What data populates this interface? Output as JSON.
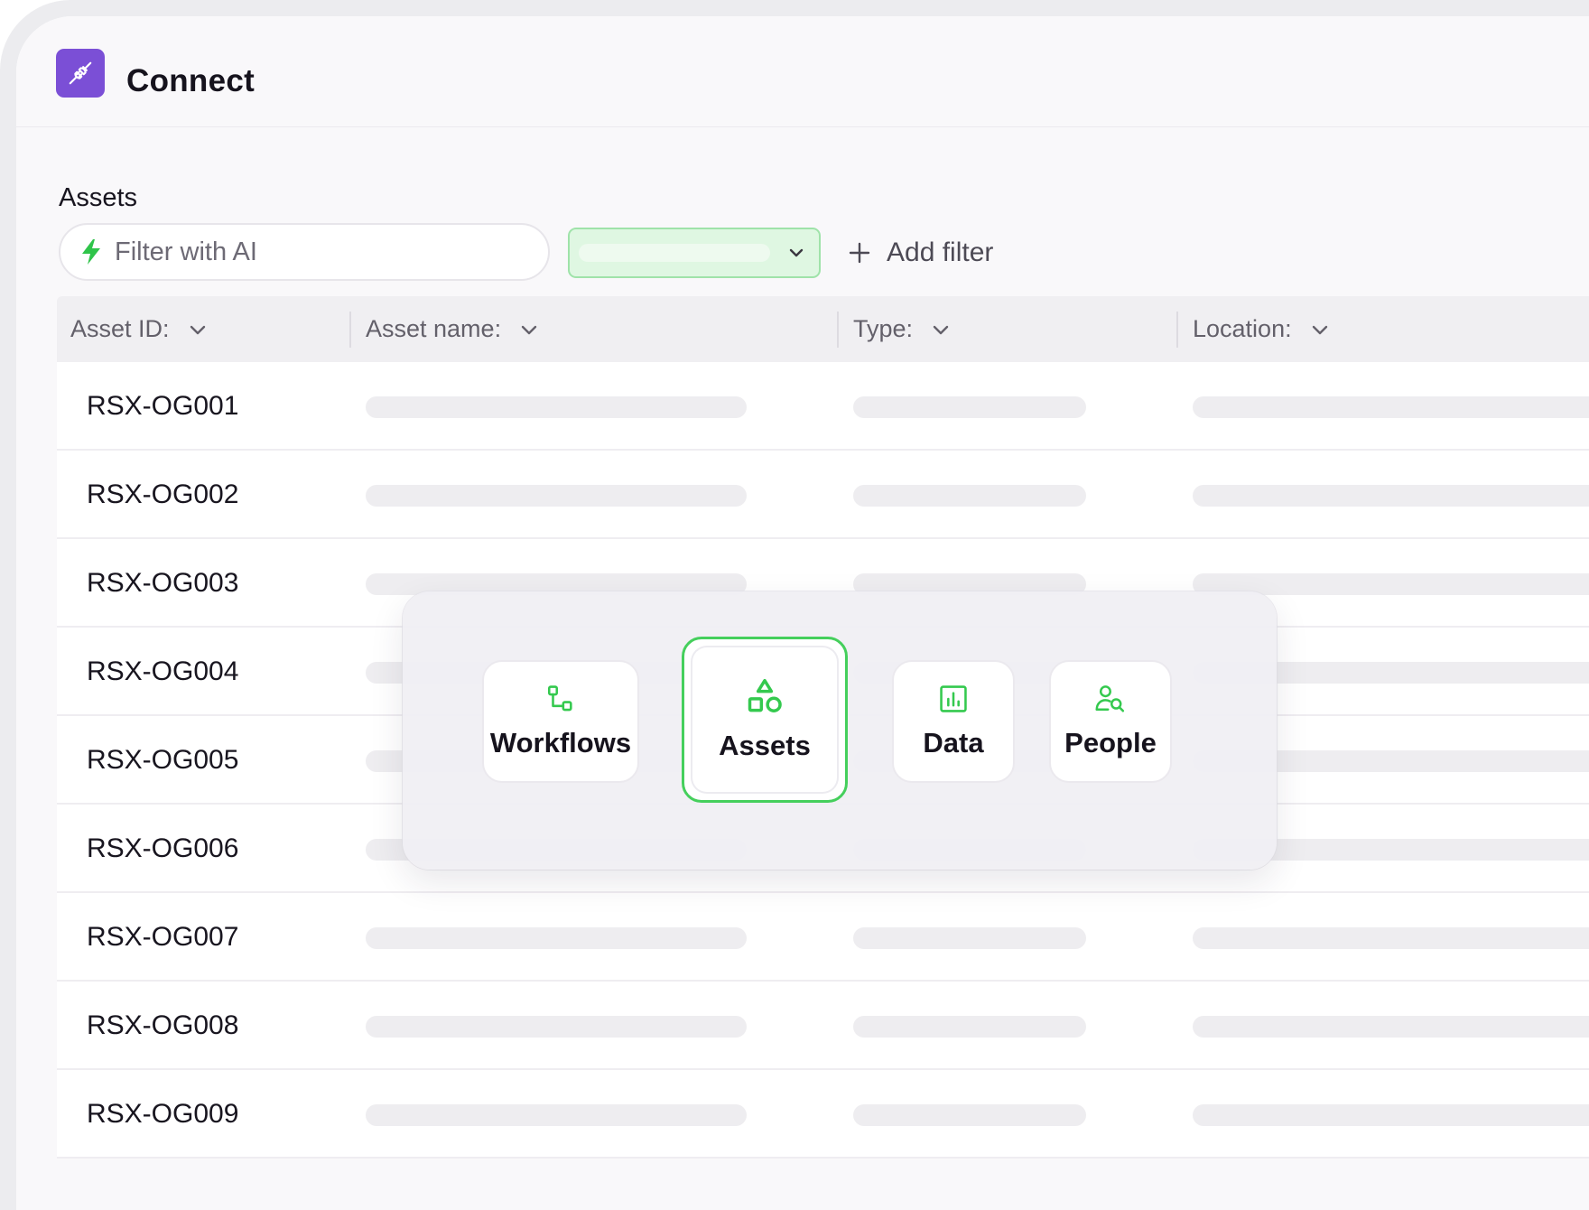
{
  "app": {
    "title": "Connect",
    "icon": "plug-icon",
    "accent_color": "#7b4fd6"
  },
  "page": {
    "section_title": "Assets"
  },
  "filters": {
    "ai_placeholder": "Filter with AI",
    "ai_icon": "lightning-bolt-icon",
    "select_color": "#dff7e2",
    "add_filter_label": "Add filter"
  },
  "table": {
    "columns": [
      {
        "label": "Asset ID:"
      },
      {
        "label": "Asset name:"
      },
      {
        "label": "Type:"
      },
      {
        "label": "Location:"
      }
    ],
    "rows": [
      {
        "asset_id": "RSX-OG001"
      },
      {
        "asset_id": "RSX-OG002"
      },
      {
        "asset_id": "RSX-OG003"
      },
      {
        "asset_id": "RSX-OG004"
      },
      {
        "asset_id": "RSX-OG005"
      },
      {
        "asset_id": "RSX-OG006"
      },
      {
        "asset_id": "RSX-OG007"
      },
      {
        "asset_id": "RSX-OG008"
      },
      {
        "asset_id": "RSX-OG009"
      }
    ]
  },
  "category_picker": {
    "selected": "Assets",
    "accent_color": "#45cf5c",
    "items": [
      {
        "label": "Workflows",
        "icon": "workflow-icon"
      },
      {
        "label": "Assets",
        "icon": "shapes-icon"
      },
      {
        "label": "Data",
        "icon": "bar-chart-icon"
      },
      {
        "label": "People",
        "icon": "person-search-icon"
      }
    ]
  }
}
